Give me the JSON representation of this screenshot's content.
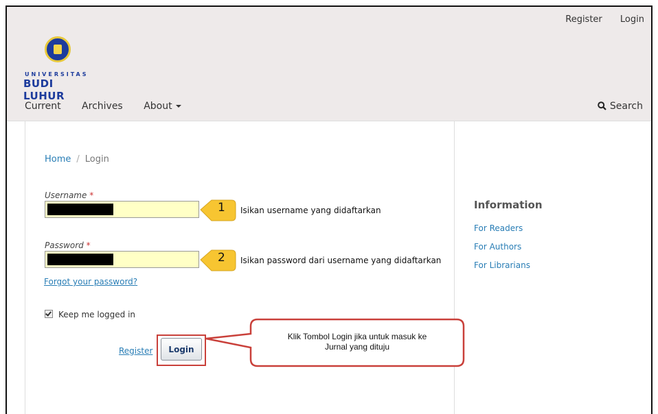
{
  "header": {
    "user_links": {
      "register": "Register",
      "login": "Login"
    },
    "logo": {
      "line1": "UNIVERSITAS",
      "line2": "BUDI LUHUR"
    },
    "nav": {
      "current": "Current",
      "archives": "Archives",
      "about": "About"
    },
    "search_label": "Search"
  },
  "breadcrumb": {
    "home": "Home",
    "separator": "/",
    "current": "Login"
  },
  "form": {
    "username_label": "Username",
    "password_label": "Password",
    "required_mark": "*",
    "forgot_link": "Forgot your password?",
    "keep_logged_in": "Keep me logged in",
    "keep_checked": true,
    "register_link": "Register",
    "login_button": "Login"
  },
  "annotations": {
    "step1_number": "1",
    "step1_text": "Isikan username yang didaftarkan",
    "step2_number": "2",
    "step2_text": "Isikan password dari username yang didaftarkan",
    "login_callout_line1": "Klik Tombol Login jika untuk masuk ke",
    "login_callout_line2": "Jurnal yang dituju"
  },
  "sidebar": {
    "title": "Information",
    "links": [
      "For Readers",
      "For Authors",
      "For Librarians"
    ]
  },
  "colors": {
    "link": "#287db5",
    "header_bg": "#eeeaea",
    "callout_yellow": "#f7c531",
    "callout_border": "#c9403a",
    "input_bg": "#ffffc6"
  }
}
